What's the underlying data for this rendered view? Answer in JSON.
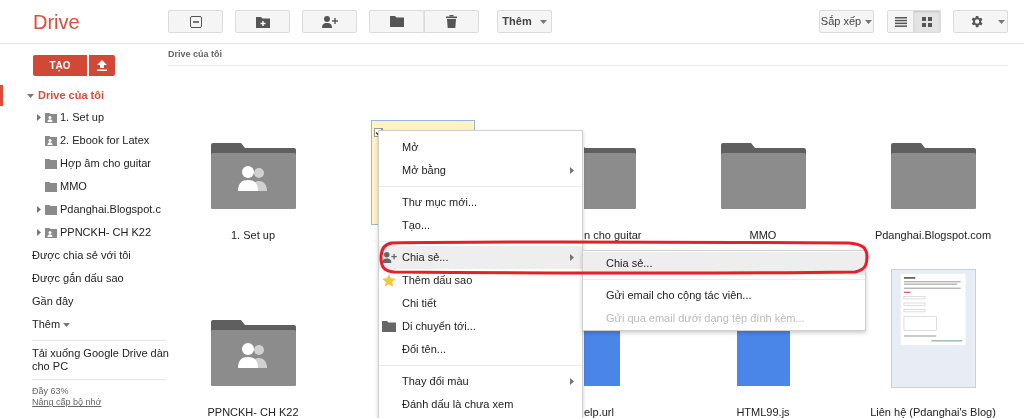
{
  "app": {
    "title": "Drive"
  },
  "toolbar": {
    "buttons": [
      {
        "kind": "remove"
      },
      {
        "kind": "new-folder"
      },
      {
        "kind": "share"
      }
    ],
    "group": [
      {
        "kind": "move"
      },
      {
        "kind": "delete"
      }
    ],
    "more": {
      "label": "Thêm"
    },
    "sort": {
      "label": "Sắp xếp"
    },
    "views": [
      {
        "kind": "list",
        "selected": false
      },
      {
        "kind": "grid",
        "selected": true
      }
    ]
  },
  "sidebar": {
    "create_button": "TẠO",
    "my_drive": {
      "label": "Drive của tôi",
      "selected": true
    },
    "tree": [
      {
        "label": "1. Set up",
        "kind": "shared-folder",
        "expandable": true
      },
      {
        "label": "2. Ebook for Latex",
        "kind": "shared-folder",
        "expandable": false
      },
      {
        "label": "Hợp âm cho guitar",
        "kind": "folder",
        "expandable": false
      },
      {
        "label": "MMO",
        "kind": "folder",
        "expandable": false
      },
      {
        "label": "Pdanghai.Blogspot.c",
        "kind": "folder",
        "expandable": true
      },
      {
        "label": "PPNCKH- CH K22",
        "kind": "shared-folder",
        "expandable": true
      }
    ],
    "nav": [
      {
        "label": "Được chia sẻ với tôi",
        "dropdown": false
      },
      {
        "label": "Được gắn dấu sao",
        "dropdown": false
      },
      {
        "label": "Gần đây",
        "dropdown": false
      },
      {
        "label": "Thêm",
        "dropdown": true
      }
    ],
    "download": [
      "Tải xuống Google Drive dàn",
      "cho PC"
    ],
    "storage": "Đầy 63%",
    "upgrade_link": "Nâng cấp bộ nhớ"
  },
  "breadcrumb": "Drive của tôi",
  "items": [
    {
      "label": "1. Set up",
      "kind": "shared-folder",
      "selected": false
    },
    {
      "selected": true
    },
    {
      "label": "n cho guitar",
      "kind": "folder",
      "selected": false
    },
    {
      "label": "MMO",
      "kind": "folder",
      "selected": false
    },
    {
      "label": "Pdanghai.Blogspot.com",
      "kind": "folder",
      "selected": false
    },
    {
      "label": "PPNCKH- CH K22",
      "kind": "shared-folder",
      "selected": false
    },
    {
      "label": "elp.url",
      "kind": "doc",
      "selected": false
    },
    {
      "label": "HTML99.js",
      "kind": "doc",
      "selected": false
    },
    {
      "label": "Liên hệ (Pdanghai's Blog)",
      "kind": "picture",
      "selected": false
    }
  ],
  "context_menu": {
    "groups": [
      [
        {
          "label": "Mở",
          "kind": "plain",
          "submenu": false,
          "highlighted": false
        },
        {
          "label": "Mở bằng",
          "kind": "plain",
          "submenu": true,
          "highlighted": false
        }
      ],
      [
        {
          "label": "Thư mục mới...",
          "kind": "plain",
          "submenu": false,
          "highlighted": false
        },
        {
          "label": "Tạo...",
          "kind": "plain",
          "submenu": false,
          "highlighted": false
        }
      ],
      [
        {
          "label": "Chia sẻ...",
          "kind": "share",
          "submenu": true,
          "highlighted": true
        },
        {
          "label": "Thêm dấu sao",
          "kind": "star",
          "submenu": false,
          "highlighted": false
        },
        {
          "label": "Chi tiết",
          "kind": "plain",
          "submenu": false,
          "highlighted": false
        },
        {
          "label": "Di chuyển tới...",
          "kind": "move",
          "submenu": false,
          "highlighted": false
        },
        {
          "label": "Đổi tên...",
          "kind": "plain",
          "submenu": false,
          "highlighted": false
        }
      ],
      [
        {
          "label": "Thay đổi màu",
          "kind": "plain",
          "submenu": true,
          "highlighted": false
        },
        {
          "label": "Đánh dấu là chưa xem",
          "kind": "plain",
          "submenu": false,
          "highlighted": false
        }
      ]
    ]
  },
  "submenu": {
    "groups": [
      [
        {
          "label": "Chia sẻ...",
          "highlighted": true,
          "disabled": false
        }
      ],
      [
        {
          "label": "Gửi email cho cộng tác viên...",
          "highlighted": false,
          "disabled": false
        },
        {
          "label": "Gửi qua email dưới dạng tệp đính kèm...",
          "highlighted": false,
          "disabled": true
        }
      ]
    ]
  }
}
